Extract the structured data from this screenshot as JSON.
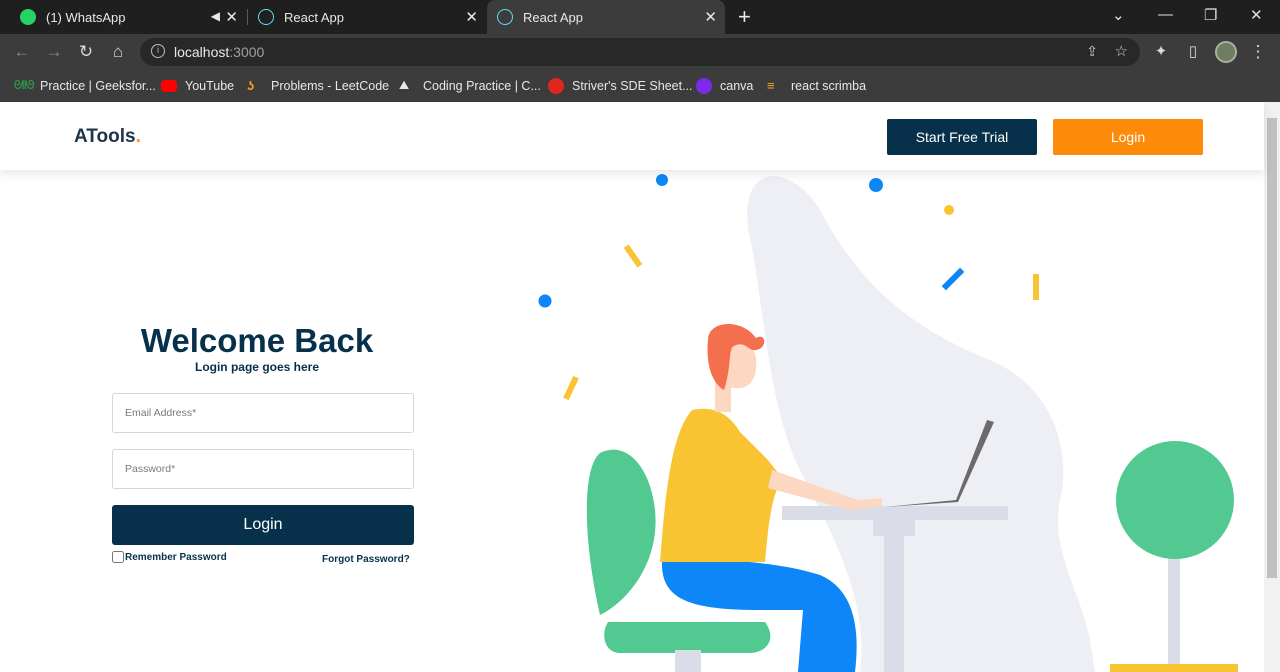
{
  "browser": {
    "tabs": [
      {
        "label": "(1) WhatsApp",
        "muted": true
      },
      {
        "label": "React App"
      },
      {
        "label": "React App",
        "active": true
      }
    ],
    "url_host": "localhost",
    "url_port": ":3000",
    "bookmarks": [
      {
        "label": "Practice | Geeksfor...",
        "icon": "gfg-icon"
      },
      {
        "label": "YouTube",
        "icon": "youtube-icon"
      },
      {
        "label": "Problems - LeetCode",
        "icon": "leetcode-icon"
      },
      {
        "label": "Coding Practice | C...",
        "icon": "codingninjas-icon"
      },
      {
        "label": "Striver's SDE Sheet...",
        "icon": "tuf-icon"
      },
      {
        "label": "canva",
        "icon": "canva-icon"
      },
      {
        "label": "react scrimba",
        "icon": "scrimba-icon"
      }
    ]
  },
  "header": {
    "logo": "ATools",
    "logo_dot": ".",
    "trial_label": "Start Free Trial",
    "login_label": "Login"
  },
  "login": {
    "title": "Welcome Back",
    "subtitle": "Login page goes here",
    "email_placeholder": "Email Address*",
    "password_placeholder": "Password*",
    "submit_label": "Login",
    "remember_label": "Remember Password",
    "forgot_label": "Forgot Password?"
  },
  "colors": {
    "primary": "#07314a",
    "accent": "#fd8a08",
    "green": "#52c990",
    "blue": "#0d87f7",
    "yellow": "#f8c431"
  }
}
